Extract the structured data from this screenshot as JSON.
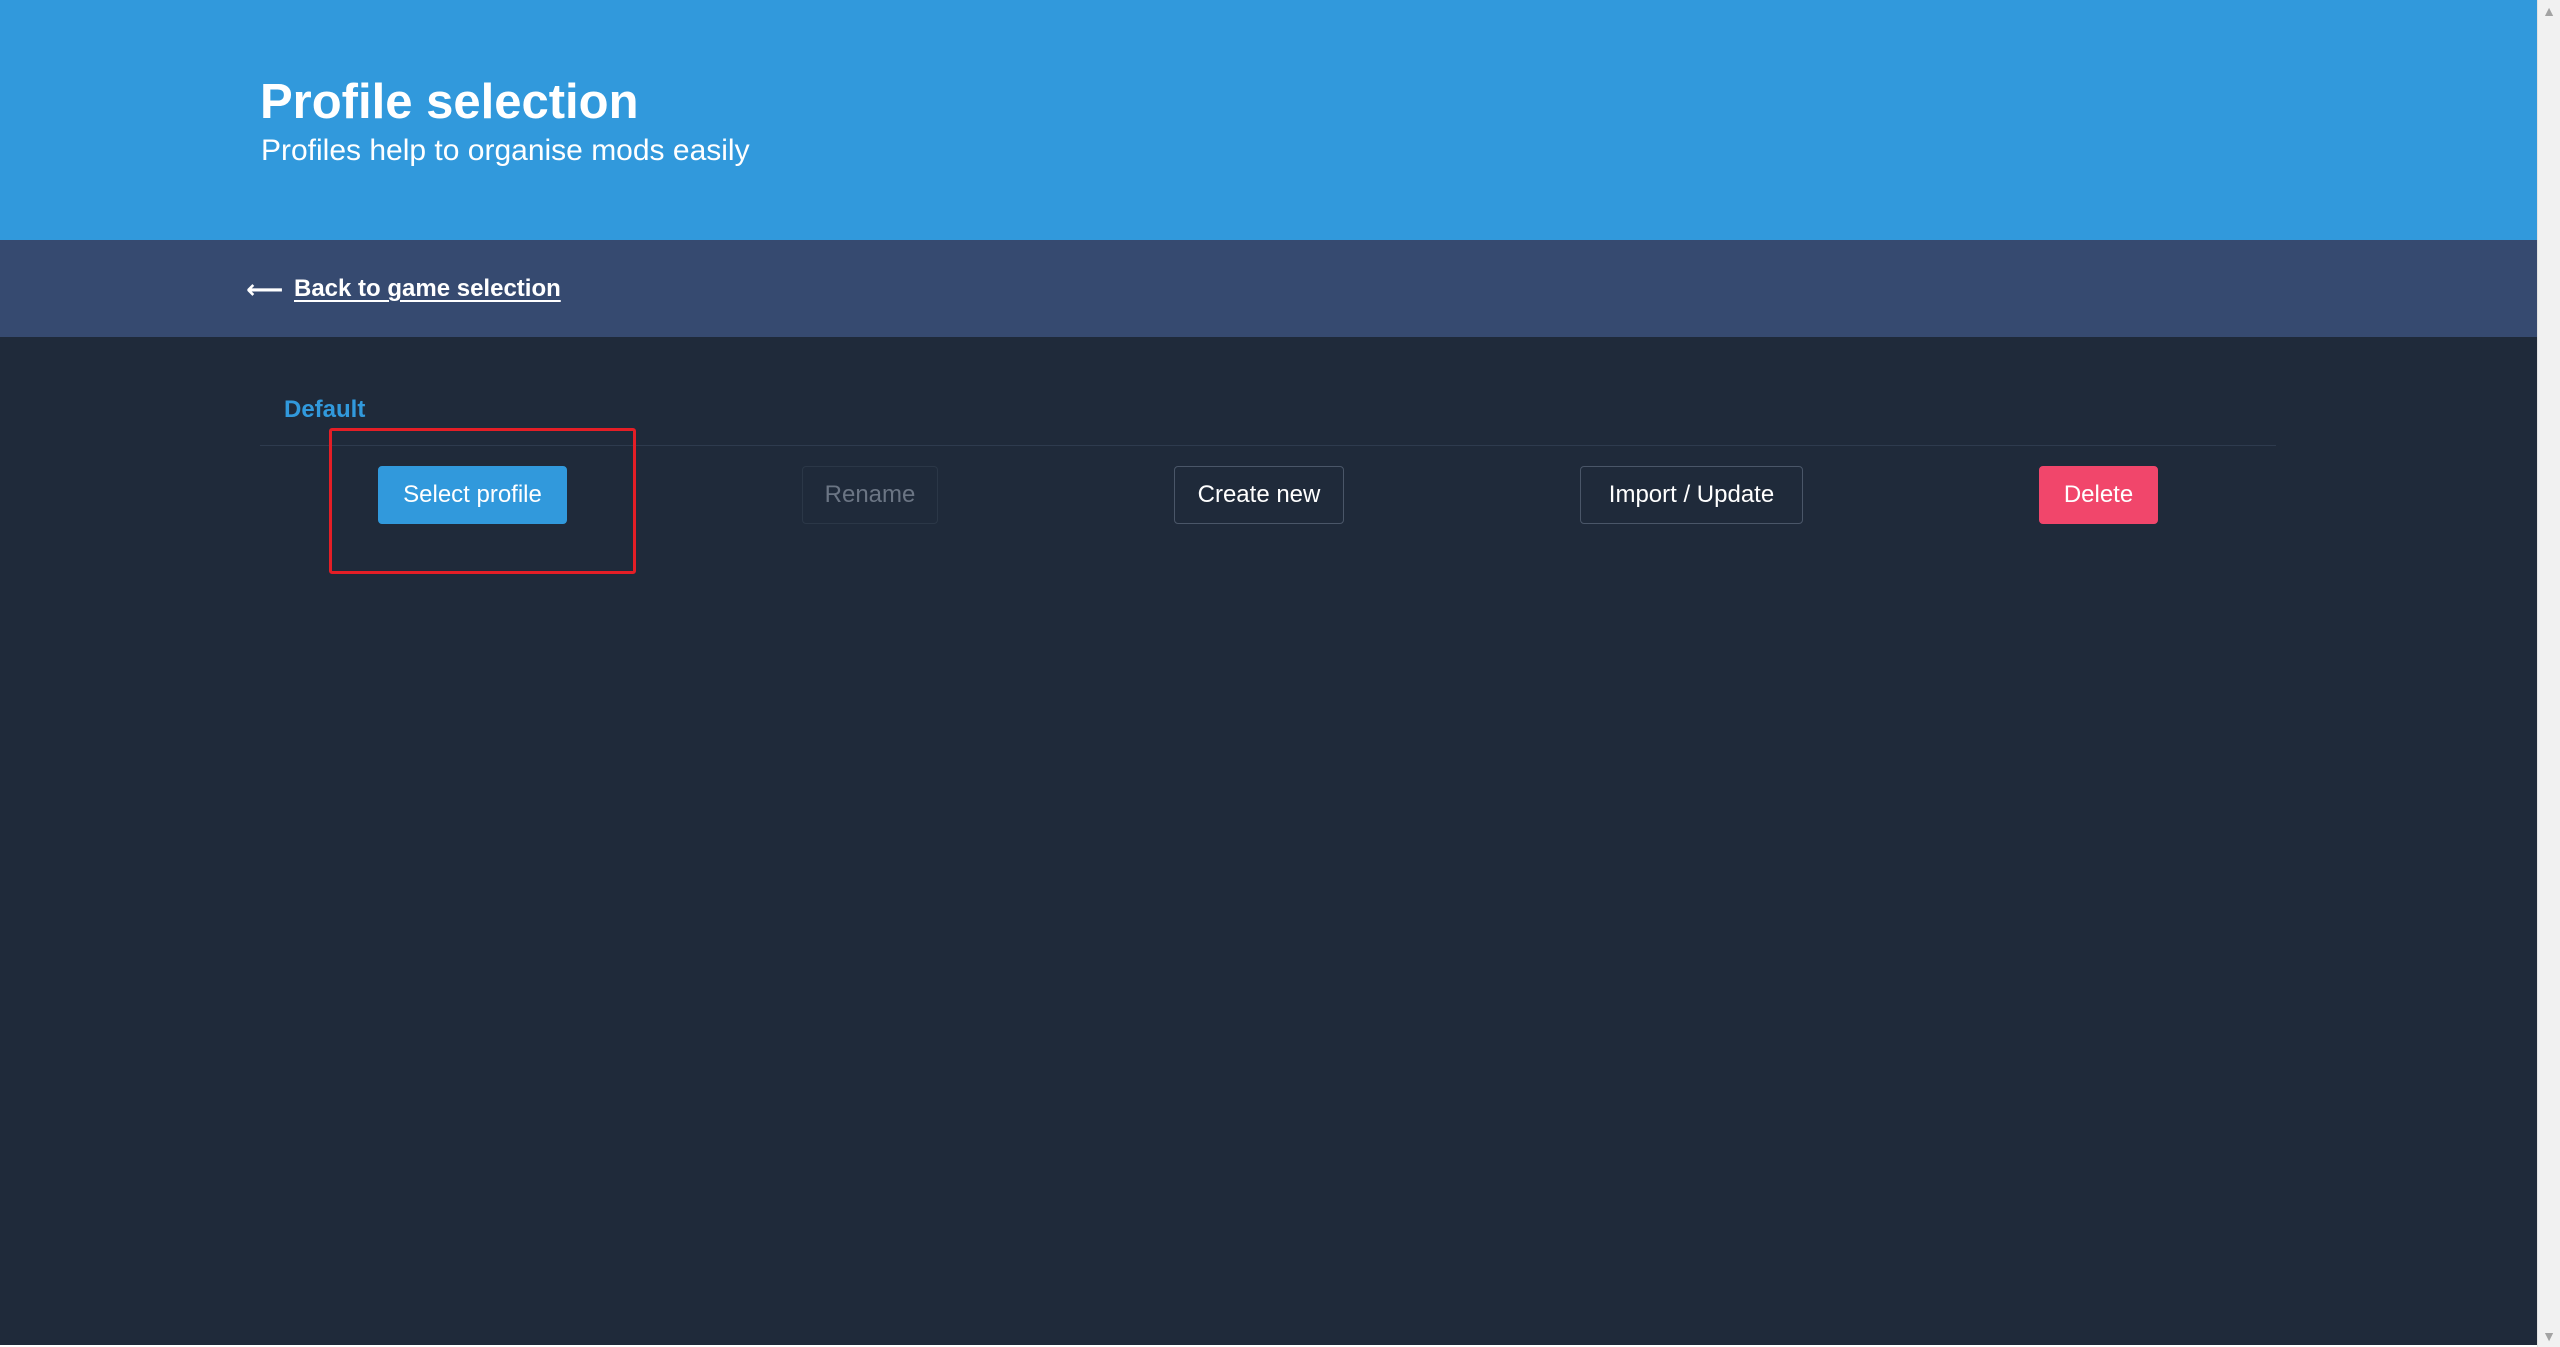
{
  "header": {
    "title": "Profile selection",
    "subtitle": "Profiles help to organise mods easily"
  },
  "nav": {
    "back_icon": "arrow-left-icon",
    "back_label": "Back to game selection"
  },
  "profile": {
    "name": "Default"
  },
  "actions": {
    "select": "Select profile",
    "rename": "Rename",
    "create": "Create new",
    "import": "Import / Update",
    "delete": "Delete"
  },
  "scrollbar": {
    "up_icon": "scroll-up-arrow-icon",
    "down_icon": "scroll-down-arrow-icon"
  },
  "colors": {
    "header_bg": "#3199dc",
    "nav_bg": "#364a70",
    "page_bg": "#1f2a3a",
    "primary": "#3199dc",
    "danger": "#f1466b",
    "highlight": "#e41e26"
  }
}
